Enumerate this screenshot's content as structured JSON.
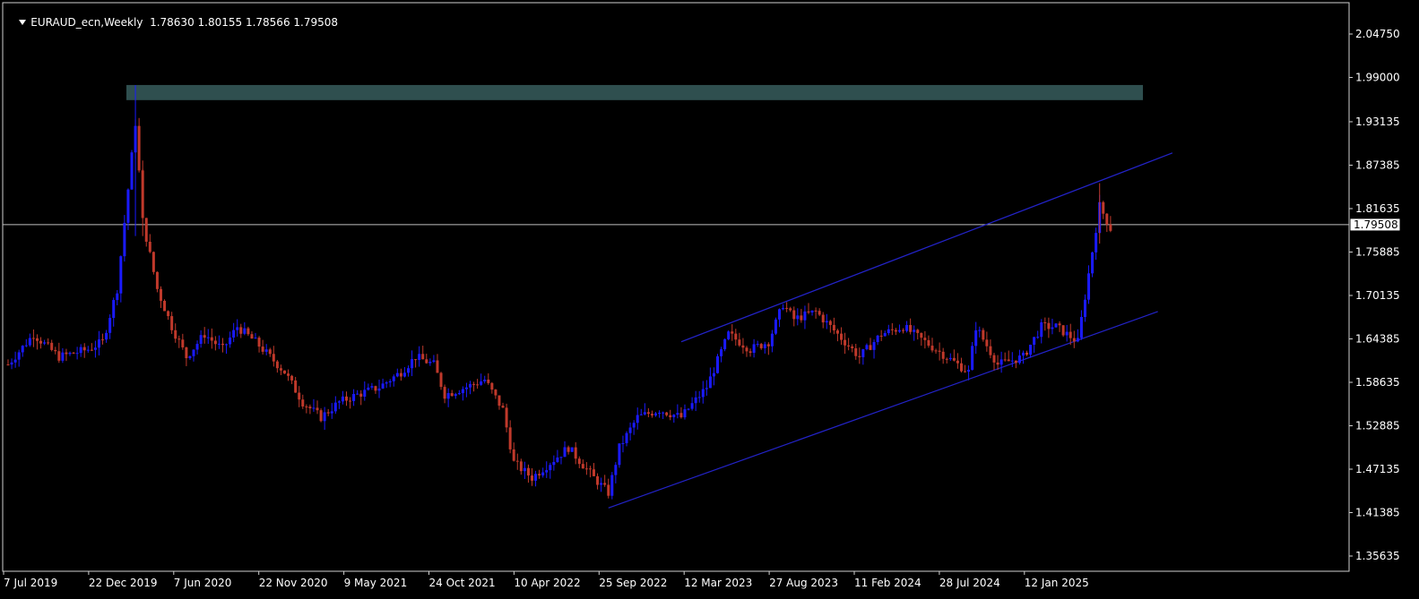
{
  "header": {
    "symbol": "EURAUD_ecn,Weekly",
    "ohlc": "1.78630 1.80155 1.78566 1.79508"
  },
  "colors": {
    "background": "#000000",
    "bull_candle": "#1a1aff",
    "bear_candle": "#c0392b",
    "zone": "#2f4f4f",
    "channel": "#2323c8",
    "hline": "#c0c0c0",
    "axis_text": "#ffffff"
  },
  "chart_data": {
    "type": "candlestick",
    "title": "EURAUD_ecn,Weekly",
    "y_ticks": [
      "2.04750",
      "1.99000",
      "1.93135",
      "1.87385",
      "1.81635",
      "1.75885",
      "1.70135",
      "1.64385",
      "1.58635",
      "1.52885",
      "1.47135",
      "1.41385",
      "1.35635"
    ],
    "current_price": "1.79508",
    "x_ticks": [
      "7 Jul 2019",
      "22 Dec 2019",
      "7 Jun 2020",
      "22 Nov 2020",
      "9 May 2021",
      "24 Oct 2021",
      "10 Apr 2022",
      "25 Sep 2022",
      "12 Mar 2023",
      "27 Aug 2023",
      "11 Feb 2024",
      "28 Jul 2024",
      "12 Jan 2025"
    ],
    "price_path": [
      [
        "2019-07-07",
        1.61
      ],
      [
        "2019-08-25",
        1.65
      ],
      [
        "2019-10-13",
        1.62
      ],
      [
        "2019-12-08",
        1.63
      ],
      [
        "2020-01-05",
        1.64
      ],
      [
        "2020-02-02",
        1.71
      ],
      [
        "2020-03-08",
        1.93
      ],
      [
        "2020-03-22",
        1.8
      ],
      [
        "2020-04-19",
        1.71
      ],
      [
        "2020-05-17",
        1.66
      ],
      [
        "2020-06-14",
        1.62
      ],
      [
        "2020-07-19",
        1.65
      ],
      [
        "2020-08-23",
        1.63
      ],
      [
        "2020-09-20",
        1.66
      ],
      [
        "2020-10-25",
        1.64
      ],
      [
        "2020-11-22",
        1.62
      ],
      [
        "2020-12-20",
        1.6
      ],
      [
        "2021-01-24",
        1.56
      ],
      [
        "2021-02-28",
        1.54
      ],
      [
        "2021-04-04",
        1.56
      ],
      [
        "2021-05-09",
        1.57
      ],
      [
        "2021-06-20",
        1.58
      ],
      [
        "2021-08-01",
        1.6
      ],
      [
        "2021-08-29",
        1.62
      ],
      [
        "2021-10-03",
        1.61
      ],
      [
        "2021-10-24",
        1.57
      ],
      [
        "2021-12-05",
        1.58
      ],
      [
        "2022-01-09",
        1.59
      ],
      [
        "2022-02-13",
        1.55
      ],
      [
        "2022-03-06",
        1.48
      ],
      [
        "2022-04-10",
        1.46
      ],
      [
        "2022-05-15",
        1.48
      ],
      [
        "2022-06-19",
        1.5
      ],
      [
        "2022-08-07",
        1.46
      ],
      [
        "2022-09-04",
        1.44
      ],
      [
        "2022-09-25",
        1.5
      ],
      [
        "2022-10-30",
        1.54
      ],
      [
        "2022-12-11",
        1.55
      ],
      [
        "2023-01-22",
        1.54
      ],
      [
        "2023-03-12",
        1.58
      ],
      [
        "2023-04-23",
        1.65
      ],
      [
        "2023-06-04",
        1.63
      ],
      [
        "2023-07-09",
        1.64
      ],
      [
        "2023-08-06",
        1.69
      ],
      [
        "2023-08-27",
        1.67
      ],
      [
        "2023-10-08",
        1.68
      ],
      [
        "2023-11-19",
        1.65
      ],
      [
        "2023-12-31",
        1.62
      ],
      [
        "2024-02-11",
        1.65
      ],
      [
        "2024-03-24",
        1.66
      ],
      [
        "2024-05-05",
        1.64
      ],
      [
        "2024-06-16",
        1.62
      ],
      [
        "2024-07-28",
        1.6
      ],
      [
        "2024-08-11",
        1.66
      ],
      [
        "2024-09-22",
        1.61
      ],
      [
        "2024-11-10",
        1.62
      ],
      [
        "2024-12-15",
        1.66
      ],
      [
        "2025-01-12",
        1.66
      ],
      [
        "2025-02-23",
        1.64
      ],
      [
        "2025-03-16",
        1.73
      ],
      [
        "2025-04-06",
        1.82
      ],
      [
        "2025-04-27",
        1.79
      ]
    ],
    "resistance_zone": [
      1.96,
      1.98
    ],
    "upper_channel": [
      [
        "2023-01-22",
        1.64
      ],
      [
        "2025-08-24",
        1.89
      ]
    ],
    "lower_channel": [
      [
        "2022-09-04",
        1.42
      ],
      [
        "2025-07-27",
        1.68
      ]
    ]
  }
}
